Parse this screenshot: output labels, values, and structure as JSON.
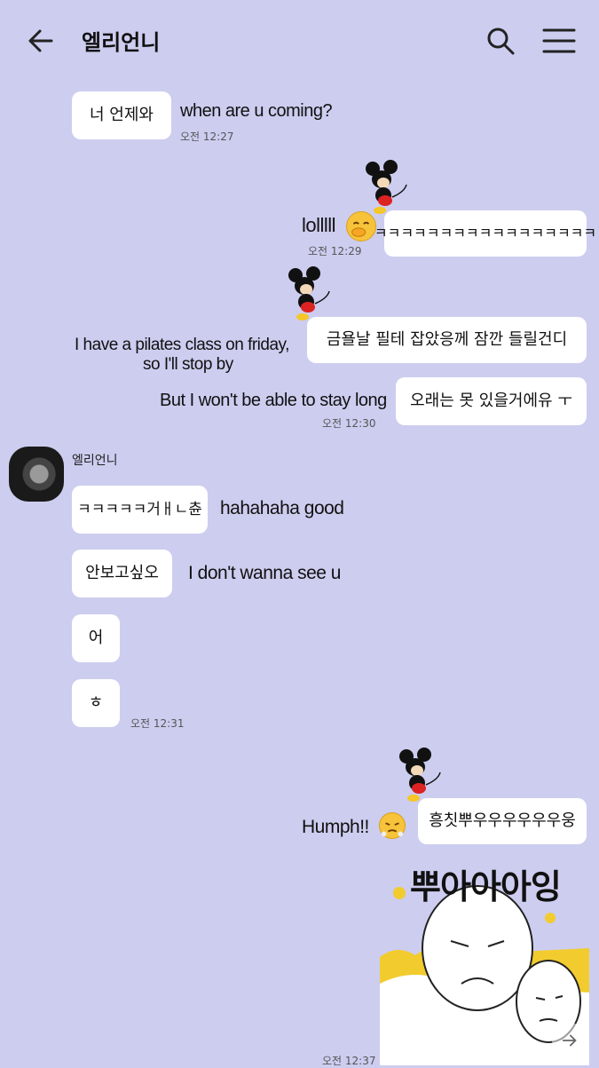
{
  "header": {
    "title": "엘리언니",
    "back_icon": "arrow-left-icon",
    "search_icon": "search-icon",
    "menu_icon": "hamburger-menu-icon"
  },
  "messages": {
    "m1": {
      "text": "너 언제와",
      "note": "when are u coming?",
      "time": "오전 12:27"
    },
    "m2": {
      "text": "ㅋㅋㅋㅋㅋㅋㅋㅋㅋㅋㅋㅋㅋㅋㅋㅋㅋ",
      "note": "lolllll",
      "time": "오전 12:29"
    },
    "m3": {
      "text": "금욜날 필테 잡았응께 잠깐 들릴건디",
      "note_line1": "I have a pilates class on friday,",
      "note_line2": "so I'll stop by"
    },
    "m4": {
      "text": "오래는 못 있을거에유 ㅜ",
      "note": "But I won't be able to stay long",
      "time": "오전 12:30"
    },
    "sender": {
      "name": "엘리언니"
    },
    "m5": {
      "text": "ㅋㅋㅋㅋㅋ거ㅐㄴ츈",
      "note": "hahahaha good"
    },
    "m6": {
      "text": "안보고싶오",
      "note": "I don't wanna see u"
    },
    "m7": {
      "text": "어"
    },
    "m8": {
      "text": "ㅎ",
      "time": "오전 12:31"
    },
    "m9": {
      "text": "흥칫뿌우우우우우우웅",
      "note": "Humph!!"
    },
    "m10": {
      "sticker_text": "뿌아아아잉",
      "time": "오전 12:37"
    }
  },
  "colors": {
    "background": "#cdcdf0",
    "bubble": "#ffffff",
    "sticker_yellow": "#f2cc2e"
  },
  "icons": {
    "sticker_character": "mickey-mouse",
    "emoji_hand_over_mouth": "face-with-hand-over-mouth",
    "emoji_huff": "face-with-steam-from-nose",
    "share": "share-arrow-icon"
  }
}
